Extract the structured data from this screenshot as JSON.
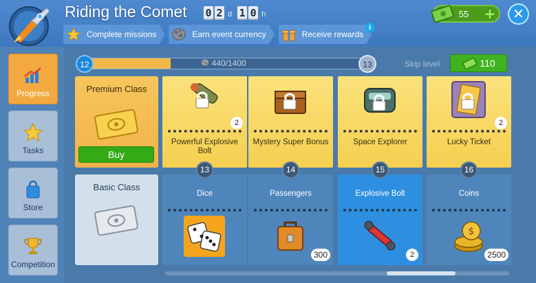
{
  "header": {
    "title": "Riding the Comet",
    "timer": {
      "d1": "0",
      "d2": "2",
      "unit1": "d",
      "h1": "1",
      "h2": "0",
      "unit2": "h"
    },
    "chips": [
      {
        "label": "Complete missions",
        "icon": "star-icon"
      },
      {
        "label": "Earn event currency",
        "icon": "asteroid-icon"
      },
      {
        "label": "Receive rewards",
        "icon": "gift-icon"
      }
    ],
    "info": "i",
    "currency": {
      "amount": "55",
      "icon": "cash-icon",
      "plus": "+"
    },
    "close": "✕"
  },
  "sidebar": {
    "items": [
      {
        "label": "Progress",
        "icon": "chart-icon",
        "active": true
      },
      {
        "label": "Tasks",
        "icon": "star-icon",
        "active": false
      },
      {
        "label": "Store",
        "icon": "shopping-bag-icon",
        "active": false
      },
      {
        "label": "Competition",
        "icon": "trophy-icon",
        "active": false
      }
    ]
  },
  "progress": {
    "current_level": "12",
    "next_level": "13",
    "points_text": "440/1400",
    "fraction": 0.314,
    "skip_label": "Skip level",
    "skip_cost": "110"
  },
  "classes": {
    "premium": {
      "title": "Premium Class",
      "buy": "Buy"
    },
    "basic": {
      "title": "Basic Class"
    }
  },
  "levels": [
    {
      "level": "13",
      "premium": {
        "name": "Powerful Explosive Bolt",
        "count": "2",
        "icon": "explosive-bolt-icon",
        "locked": true
      },
      "basic": {
        "name": "Dice",
        "count": "",
        "icon": "dice-icon",
        "selected": false
      }
    },
    {
      "level": "14",
      "premium": {
        "name": "Mystery Super Bonus",
        "count": "",
        "icon": "chest-icon",
        "locked": true
      },
      "basic": {
        "name": "Passengers",
        "count": "300",
        "icon": "suitcase-icon",
        "selected": false
      }
    },
    {
      "level": "15",
      "premium": {
        "name": "Space Explorer",
        "count": "",
        "icon": "space-train-icon",
        "locked": true
      },
      "basic": {
        "name": "Explosive Bolt",
        "count": "2",
        "icon": "bolt-icon",
        "selected": true
      }
    },
    {
      "level": "16",
      "premium": {
        "name": "Lucky Ticket",
        "count": "2",
        "icon": "lucky-ticket-icon",
        "locked": true
      },
      "basic": {
        "name": "Coins",
        "count": "2500",
        "icon": "coins-icon",
        "selected": false
      }
    }
  ],
  "colors": {
    "accent_orange": "#f3a93f",
    "buy_green": "#33aa16",
    "premium_yellow": "#f5cf4f",
    "basic_blue": "#4e86bc"
  }
}
